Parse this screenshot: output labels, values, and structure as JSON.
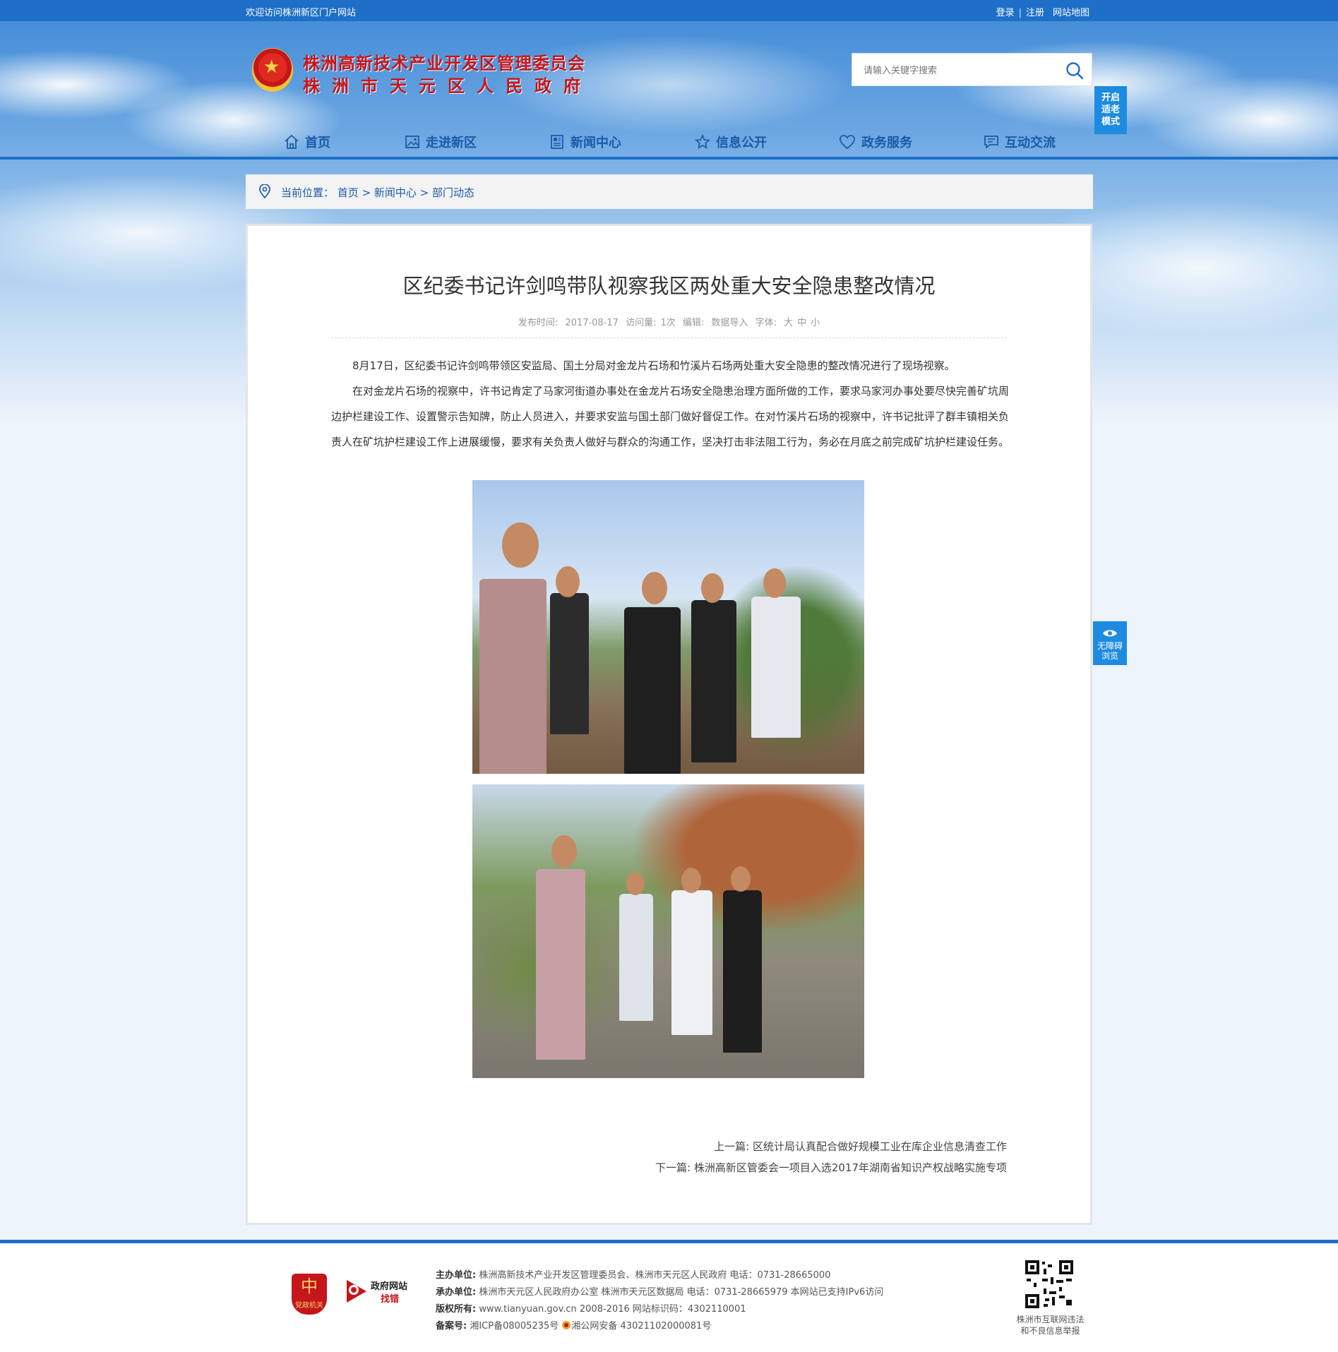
{
  "topbar": {
    "welcome": "欢迎访问株洲新区门户网站",
    "login": "登录",
    "register": "注册",
    "sitemap": "网站地图"
  },
  "logo": {
    "line1": "株洲高新技术产业开发区管理委员会",
    "line2": "株洲市天元区人民政府"
  },
  "search": {
    "placeholder": "请输入关键字搜索"
  },
  "elder_mode": "开启适老模式",
  "nav": [
    {
      "label": "首页",
      "icon": "home-icon"
    },
    {
      "label": "走进新区",
      "icon": "picture-icon"
    },
    {
      "label": "新闻中心",
      "icon": "newspaper-icon"
    },
    {
      "label": "信息公开",
      "icon": "star-icon"
    },
    {
      "label": "政务服务",
      "icon": "heart-icon"
    },
    {
      "label": "互动交流",
      "icon": "chat-icon"
    }
  ],
  "breadcrumb": {
    "prefix": "当前位置：",
    "items": [
      "首页",
      "新闻中心",
      "部门动态"
    ],
    "sep": " > "
  },
  "article": {
    "title": "区纪委书记许剑鸣带队视察我区两处重大安全隐患整改情况",
    "meta": {
      "publish_label": "发布时间:",
      "publish_date": "2017-08-17",
      "visits_label": "访问量:",
      "visits": "1次",
      "editor_label": "编辑:",
      "editor": "数据导入",
      "font_label": "字体:",
      "font_large": "大",
      "font_medium": "中",
      "font_small": "小"
    },
    "paragraphs": [
      "8月17日，区纪委书记许剑鸣带领区安监局、国土分局对金龙片石场和竹溪片石场两处重大安全隐患的整改情况进行了现场视察。",
      "在对金龙片石场的视察中，许书记肯定了马家河街道办事处在金龙片石场安全隐患治理方面所做的工作，要求马家河办事处要尽快完善矿坑周边护栏建设工作、设置警示告知牌，防止人员进入，并要求安监与国土部门做好督促工作。在对竹溪片石场的视察中，许书记批评了群丰镇相关负责人在矿坑护栏建设工作上进展缓慢，要求有关负责人做好与群众的沟通工作，坚决打击非法阻工行为，务必在月底之前完成矿坑护栏建设任务。"
    ],
    "prev_label": "上一篇:",
    "prev_title": "区统计局认真配合做好规模工业在库企业信息清查工作",
    "next_label": "下一篇:",
    "next_title": "株洲高新区管委会一项目入选2017年湖南省知识产权战略实施专项"
  },
  "accessibility": "无障碍浏览",
  "footer": {
    "badge1": "党政机关",
    "badge2_line1": "政府网站",
    "badge2_line2": "找错",
    "host_label": "主办单位:",
    "host": "株洲高新技术产业开发区管理委员会、株洲市天元区人民政府 电话：0731-28665000",
    "undertake_label": "承办单位:",
    "undertake": "株洲市天元区人民政府办公室 株洲市天元区数据局 电话：0731-28665979 本网站已支持IPv6访问",
    "copyright_label": "版权所有:",
    "copyright": "www.tianyuan.gov.cn 2008-2016 网站标识码：4302110001",
    "icp_label": "备案号:",
    "icp": "湘ICP备08005235号",
    "police": "湘公网安备 43021102000081号",
    "report_line1": "株洲市互联网违法",
    "report_line2": "和不良信息举报"
  },
  "colors": {
    "primary": "#1d6fc7",
    "nav_text": "#1a5aa8",
    "logo_red": "#c4161b"
  }
}
